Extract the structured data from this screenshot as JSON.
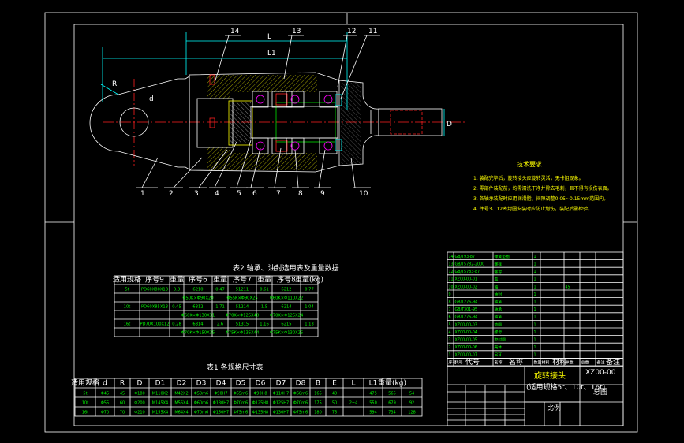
{
  "part_labels": [
    "1",
    "2",
    "3",
    "4",
    "5",
    "6",
    "7",
    "8",
    "9",
    "10",
    "11",
    "12",
    "13",
    "14"
  ],
  "dims": {
    "L": "L",
    "L1": "L1",
    "R": "R",
    "d": "d",
    "D": "D"
  },
  "tech": {
    "title": "技术要求",
    "lines": [
      "1. 装配完毕后，旋转接头应旋转灵活，无卡阻现象。",
      "2. 零部件装配前，均需清洗干净并除去毛刺，且不得有损伤表面。",
      "3. 各轴承装配时应用润滑脂，间隙调整0.05~0.15mm范围内。",
      "4. 件号3、12密封圈安装时应防止划伤，装配后需检验。"
    ]
  },
  "table2": {
    "title": "表2  轴承、油封选用表及重量数据",
    "headers": [
      "适用规格",
      "序号9",
      "重量",
      "序号6",
      "重量",
      "序号7",
      "重量",
      "序号8",
      "重量(kg)"
    ],
    "rows": [
      [
        "5t",
        "PD60X80X13",
        "0.8",
        "6210",
        "0.47",
        "51211",
        "0.61",
        "6212",
        "0.77"
      ],
      [
        "",
        "",
        "",
        "Φ50K×Φ90X20",
        "",
        "Φ55K×Φ90X25",
        "",
        "Φ60K×Φ110X22",
        ""
      ],
      [
        "10t",
        "PD60X85X13",
        "0.45",
        "6312",
        "1.71",
        "51214",
        "1.5",
        "6214",
        "1.04"
      ],
      [
        "",
        "",
        "",
        "Φ60K×Φ130X31",
        "",
        "Φ70K×Φ125X40",
        "",
        "Φ70K×Φ125X24",
        ""
      ],
      [
        "16t",
        "PD70X100X12",
        "0.28",
        "6314",
        "2.6",
        "51315",
        "1.16",
        "6215",
        "1.13"
      ],
      [
        "",
        "",
        "",
        "Φ70K×Φ150X35",
        "",
        "Φ75K×Φ135X44",
        "",
        "Φ75K×Φ130X25",
        ""
      ]
    ]
  },
  "table1": {
    "title": "表1  各规格尺寸表",
    "headers": [
      "适用规格",
      "d",
      "R",
      "D",
      "D1",
      "D2",
      "D3",
      "D4",
      "D5",
      "D6",
      "D7",
      "D8",
      "B",
      "E",
      "L",
      "L1",
      "重量(kg)"
    ],
    "rows": [
      [
        "5t",
        "Φ45",
        "45",
        "Φ180",
        "M110X2",
        "M42X2",
        "Φ50m6",
        "Φ90H7",
        "Φ55m6",
        "Φ90H8",
        "Φ110H7",
        "Φ60m6",
        "165",
        "40",
        "",
        "475",
        "565",
        "54"
      ],
      [
        "10t",
        "Φ55",
        "60",
        "Φ200",
        "M145X4",
        "M56X4",
        "Φ60m6",
        "Φ130H7",
        "Φ70m6",
        "Φ125H8",
        "Φ125H7",
        "Φ70m6",
        "175",
        "50",
        "2~4",
        "550",
        "679",
        "92"
      ],
      [
        "16t",
        "Φ70",
        "70",
        "Φ210",
        "M155X4",
        "M64X4",
        "Φ70m6",
        "Φ150H7",
        "Φ75m6",
        "Φ135H8",
        "Φ130H7",
        "Φ75m6",
        "180",
        "75",
        "",
        "594",
        "734",
        "128"
      ]
    ]
  },
  "parts_list": [
    [
      "14",
      "GB/T93-87",
      "弹簧垫圈",
      "1",
      "",
      "",
      ""
    ],
    [
      "13",
      "GB/T5782-2000",
      "螺栓",
      "1",
      "",
      "",
      ""
    ],
    [
      "12",
      "GB/T5783-87",
      "螺母",
      "1",
      "",
      "",
      ""
    ],
    [
      "11",
      "XZ00-00-01",
      "盖",
      "1",
      "",
      "",
      ""
    ],
    [
      "10",
      "XZ00-00-02",
      "轴",
      "1",
      "",
      "45",
      ""
    ],
    [
      "9",
      "",
      "油封",
      "1",
      "",
      "",
      ""
    ],
    [
      "8",
      "GB/T276-94",
      "轴承",
      "1",
      "",
      "",
      ""
    ],
    [
      "7",
      "GB/T301-95",
      "轴承",
      "1",
      "",
      "",
      ""
    ],
    [
      "6",
      "GB/T276-94",
      "轴承",
      "1",
      "",
      "",
      ""
    ],
    [
      "5",
      "XZ00-00-03",
      "垫圈",
      "1",
      "",
      "",
      ""
    ],
    [
      "4",
      "XZ00-00-04",
      "螺母",
      "1",
      "",
      "",
      ""
    ],
    [
      "3",
      "XZ00-00-05",
      "密封圈",
      "1",
      "",
      "",
      ""
    ],
    [
      "2",
      "XZ00-00-06",
      "壳体",
      "1",
      "",
      "",
      ""
    ],
    [
      "1",
      "XZ00-00-07",
      "吊耳",
      "1",
      "",
      "",
      ""
    ]
  ],
  "parts_header": [
    "序号",
    "代号",
    "名称",
    "数量",
    "材料",
    "单重",
    "总重",
    "备注"
  ],
  "title_block": {
    "name": "旋转接头",
    "sub": "(适用规格5t、10t、16t)",
    "drawing_no": "XZ00-00",
    "sheet": "总图",
    "label_code": "代号",
    "label_name": "名称",
    "label_material": "材料",
    "label_note": "备注",
    "label_scale": "比例"
  }
}
